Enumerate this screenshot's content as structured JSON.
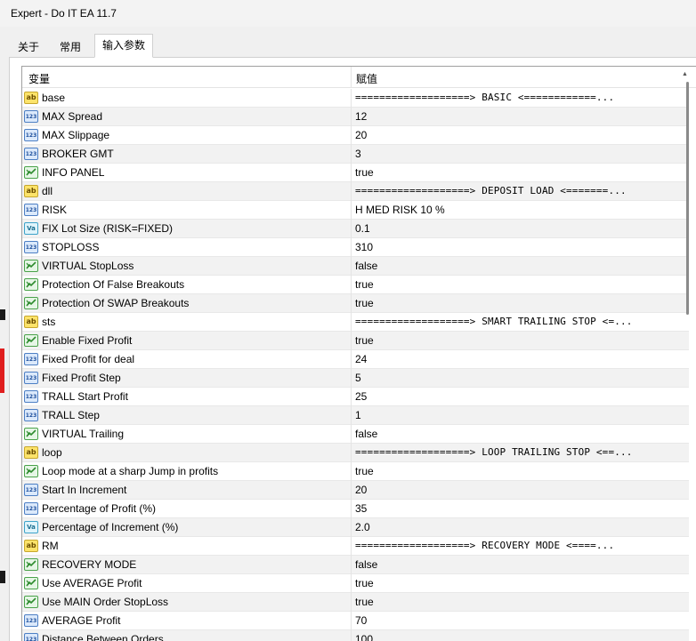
{
  "window": {
    "title": "Expert - Do IT EA 11.7"
  },
  "tabs": [
    {
      "label": "关于",
      "active": false
    },
    {
      "label": "常用",
      "active": false
    },
    {
      "label": "输入参数",
      "active": true
    }
  ],
  "grid": {
    "header": {
      "variable": "变量",
      "value": "赋值"
    },
    "rows": [
      {
        "icon": "ab-string-icon",
        "name": "base",
        "value": "===================>  BASIC   <============..."
      },
      {
        "icon": "int-123-icon",
        "name": "MAX Spread",
        "value": "12"
      },
      {
        "icon": "int-123-icon",
        "name": "MAX Slippage",
        "value": "20"
      },
      {
        "icon": "int-123-icon",
        "name": "BROKER GMT",
        "value": "3"
      },
      {
        "icon": "bool-icon",
        "name": "INFO PANEL",
        "value": "true"
      },
      {
        "icon": "ab-string-icon",
        "name": "dll",
        "value": "===================>  DEPOSIT LOAD <=======..."
      },
      {
        "icon": "int-123-icon",
        "name": "RISK",
        "value": "H MED RISK 10 %"
      },
      {
        "icon": "double-icon",
        "name": "FIX Lot Size (RISK=FIXED)",
        "value": "0.1"
      },
      {
        "icon": "int-123-icon",
        "name": "STOPLOSS",
        "value": "310"
      },
      {
        "icon": "bool-icon",
        "name": "VIRTUAL StopLoss",
        "value": "false"
      },
      {
        "icon": "bool-icon",
        "name": "Protection Of False Breakouts",
        "value": "true"
      },
      {
        "icon": "bool-icon",
        "name": "Protection Of SWAP Breakouts",
        "value": "true"
      },
      {
        "icon": "ab-string-icon",
        "name": "sts",
        "value": "===================>  SMART TRAILING STOP  <=..."
      },
      {
        "icon": "bool-icon",
        "name": "Enable Fixed Profit",
        "value": "true"
      },
      {
        "icon": "int-123-icon",
        "name": "Fixed Profit for deal",
        "value": "24"
      },
      {
        "icon": "int-123-icon",
        "name": "Fixed Profit Step",
        "value": "5"
      },
      {
        "icon": "int-123-icon",
        "name": "TRALL Start Profit",
        "value": "25"
      },
      {
        "icon": "int-123-icon",
        "name": "TRALL Step",
        "value": "1"
      },
      {
        "icon": "bool-icon",
        "name": "VIRTUAL Trailing",
        "value": "false"
      },
      {
        "icon": "ab-string-icon",
        "name": "loop",
        "value": "===================>  LOOP TRAILING STOP  <==..."
      },
      {
        "icon": "bool-icon",
        "name": "Loop mode at a sharp Jump in profits",
        "value": "true"
      },
      {
        "icon": "int-123-icon",
        "name": "Start In Increment",
        "value": "20"
      },
      {
        "icon": "int-123-icon",
        "name": "Percentage of Profit (%)",
        "value": "35"
      },
      {
        "icon": "double-icon",
        "name": "Percentage of Increment (%)",
        "value": "2.0"
      },
      {
        "icon": "ab-string-icon",
        "name": "RM",
        "value": "===================>  RECOVERY  MODE  <====..."
      },
      {
        "icon": "bool-icon",
        "name": "RECOVERY MODE",
        "value": "false"
      },
      {
        "icon": "bool-icon",
        "name": "Use AVERAGE Profit",
        "value": "true"
      },
      {
        "icon": "bool-icon",
        "name": "Use MAIN Order StopLoss",
        "value": "true"
      },
      {
        "icon": "int-123-icon",
        "name": "AVERAGE Profit",
        "value": "70"
      },
      {
        "icon": "int-123-icon",
        "name": "Distance Between Orders",
        "value": "100"
      }
    ]
  },
  "icon_glyphs": {
    "ab": "ab",
    "int": "123",
    "double": "Va"
  },
  "colors": {
    "alt_row": "#f2f2f2",
    "grid_line": "#e4e4e4",
    "window_bg": "#f0f0f0"
  }
}
